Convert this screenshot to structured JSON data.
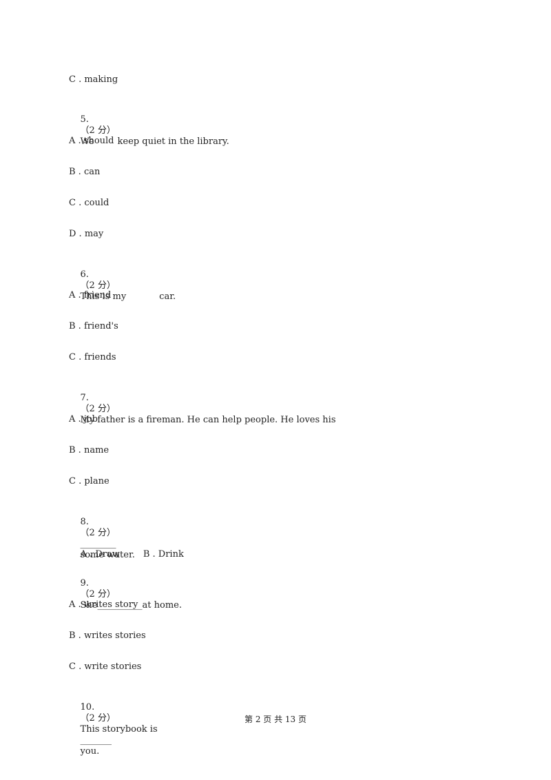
{
  "lines": {
    "q4_c": "C . making",
    "q5": {
      "num": "5.",
      "score": "（2 分）",
      "pre": "We",
      "post": "keep quiet in the library."
    },
    "q5_a": "A . should",
    "q5_b": "B . can",
    "q5_c": "C . could",
    "q5_d": "D . may",
    "q6": {
      "num": "6.",
      "score": "（2 分）",
      "pre": "This is my",
      "post": "car."
    },
    "q6_a": "A . friend",
    "q6_b": "B . friend's",
    "q6_c": "C . friends",
    "q7": {
      "num": "7.",
      "score": "（2 分）",
      "text": "My father is a fireman. He can help people. He loves his"
    },
    "q7_a": "A . job",
    "q7_b": "B . name",
    "q7_c": "C . plane",
    "q8": {
      "num": "8.",
      "score": "（2 分）",
      "blank": "________",
      "post": "some water."
    },
    "q8_a": "A . Draw",
    "q8_b": "B . Drink",
    "q9": {
      "num": "9.",
      "score": "（2 分）",
      "pre": "She",
      "blank": "__________",
      "post": "at home."
    },
    "q9_a": "A . writes story",
    "q9_b": "B . writes stories",
    "q9_c": "C . write stories",
    "q10": {
      "num": "10.",
      "score": "（2 分）",
      "pre": "This storybook is",
      "blank": "_______",
      "post": "you."
    }
  },
  "footer": "第 2 页 共 13 页"
}
